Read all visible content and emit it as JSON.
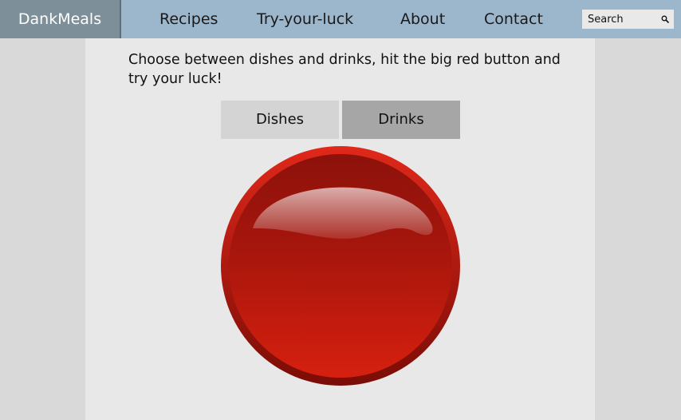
{
  "nav": {
    "brand": "DankMeals",
    "links": [
      "Recipes",
      "Try-your-luck",
      "About",
      "Contact"
    ],
    "search": {
      "placeholder": "Search",
      "icon": "search-icon"
    }
  },
  "main": {
    "intro": "Choose between dishes and drinks, hit the big red button and try your luck!",
    "toggle": {
      "options": [
        "Dishes",
        "Drinks"
      ],
      "selected": "Drinks"
    },
    "big_button": {
      "icon": "big-red-button",
      "color": "#c8180c"
    }
  },
  "colors": {
    "navbar": "#9cb6cc",
    "brand_bg": "#7d9099",
    "page_bg": "#d9d9d9",
    "content_bg": "#e8e8e8",
    "toggle_unselected": "#d4d4d4",
    "toggle_selected": "#a6a6a6"
  }
}
